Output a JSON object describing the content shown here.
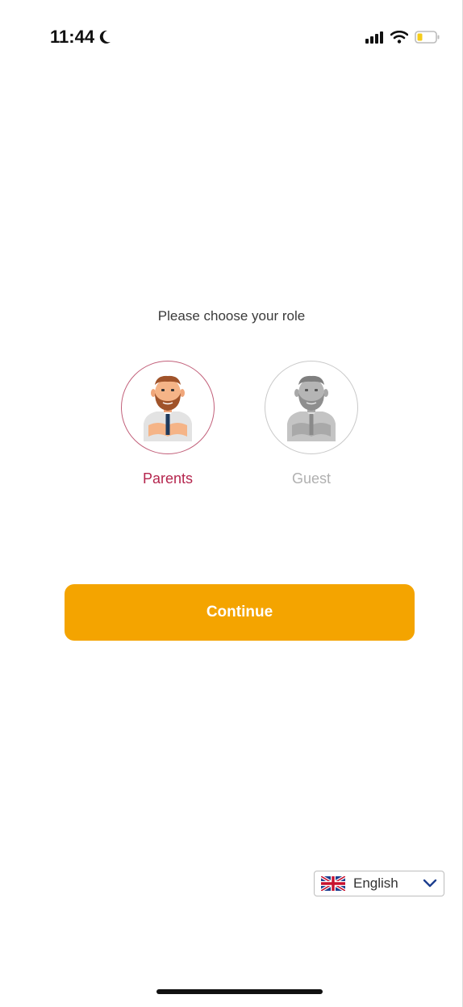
{
  "status_bar": {
    "time": "11:44",
    "icons": [
      "moon-icon",
      "cellular-signal-icon",
      "wifi-icon",
      "battery-low-icon"
    ]
  },
  "role_picker": {
    "prompt": "Please choose your role",
    "roles": [
      {
        "label": "Parents",
        "selected": true,
        "icon": "parent-avatar-icon"
      },
      {
        "label": "Guest",
        "selected": false,
        "icon": "guest-avatar-icon"
      }
    ]
  },
  "actions": {
    "continue_label": "Continue"
  },
  "language": {
    "selected": "English",
    "flag_icon": "uk-flag-icon",
    "dropdown_icon": "chevron-down-icon"
  },
  "colors": {
    "accent": "#f4a400",
    "selected_role": "#b5264e",
    "unselected_role": "#b0b0b0"
  }
}
